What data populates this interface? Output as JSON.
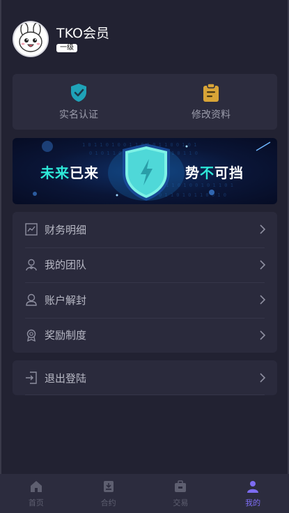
{
  "user": {
    "name": "TKO会员",
    "level": "一级"
  },
  "quick_actions": [
    {
      "label": "实名认证",
      "icon": "shield-check-icon",
      "color": "#1fa3b8"
    },
    {
      "label": "修改资料",
      "icon": "clipboard-icon",
      "color": "#d8a437"
    }
  ],
  "banner": {
    "left_highlight": "未来",
    "left_rest": "已来",
    "right_first": "势",
    "right_highlight": "不",
    "right_rest": "可挡"
  },
  "menu": [
    {
      "label": "财务明细",
      "icon": "finance-chart-icon"
    },
    {
      "label": "我的团队",
      "icon": "team-icon"
    },
    {
      "label": "账户解封",
      "icon": "user-unlock-icon"
    },
    {
      "label": "奖励制度",
      "icon": "award-icon"
    }
  ],
  "logout": {
    "label": "退出登陆",
    "icon": "logout-icon"
  },
  "tabs": [
    {
      "label": "首页",
      "icon": "home-icon",
      "active": false
    },
    {
      "label": "合约",
      "icon": "contract-icon",
      "active": false
    },
    {
      "label": "交易",
      "icon": "trade-icon",
      "active": false
    },
    {
      "label": "我的",
      "icon": "profile-icon",
      "active": true
    }
  ],
  "colors": {
    "background": "#222232",
    "card": "#2a2a3c",
    "accent": "#7d6cf2",
    "banner_highlight": "#2ee8d8"
  }
}
